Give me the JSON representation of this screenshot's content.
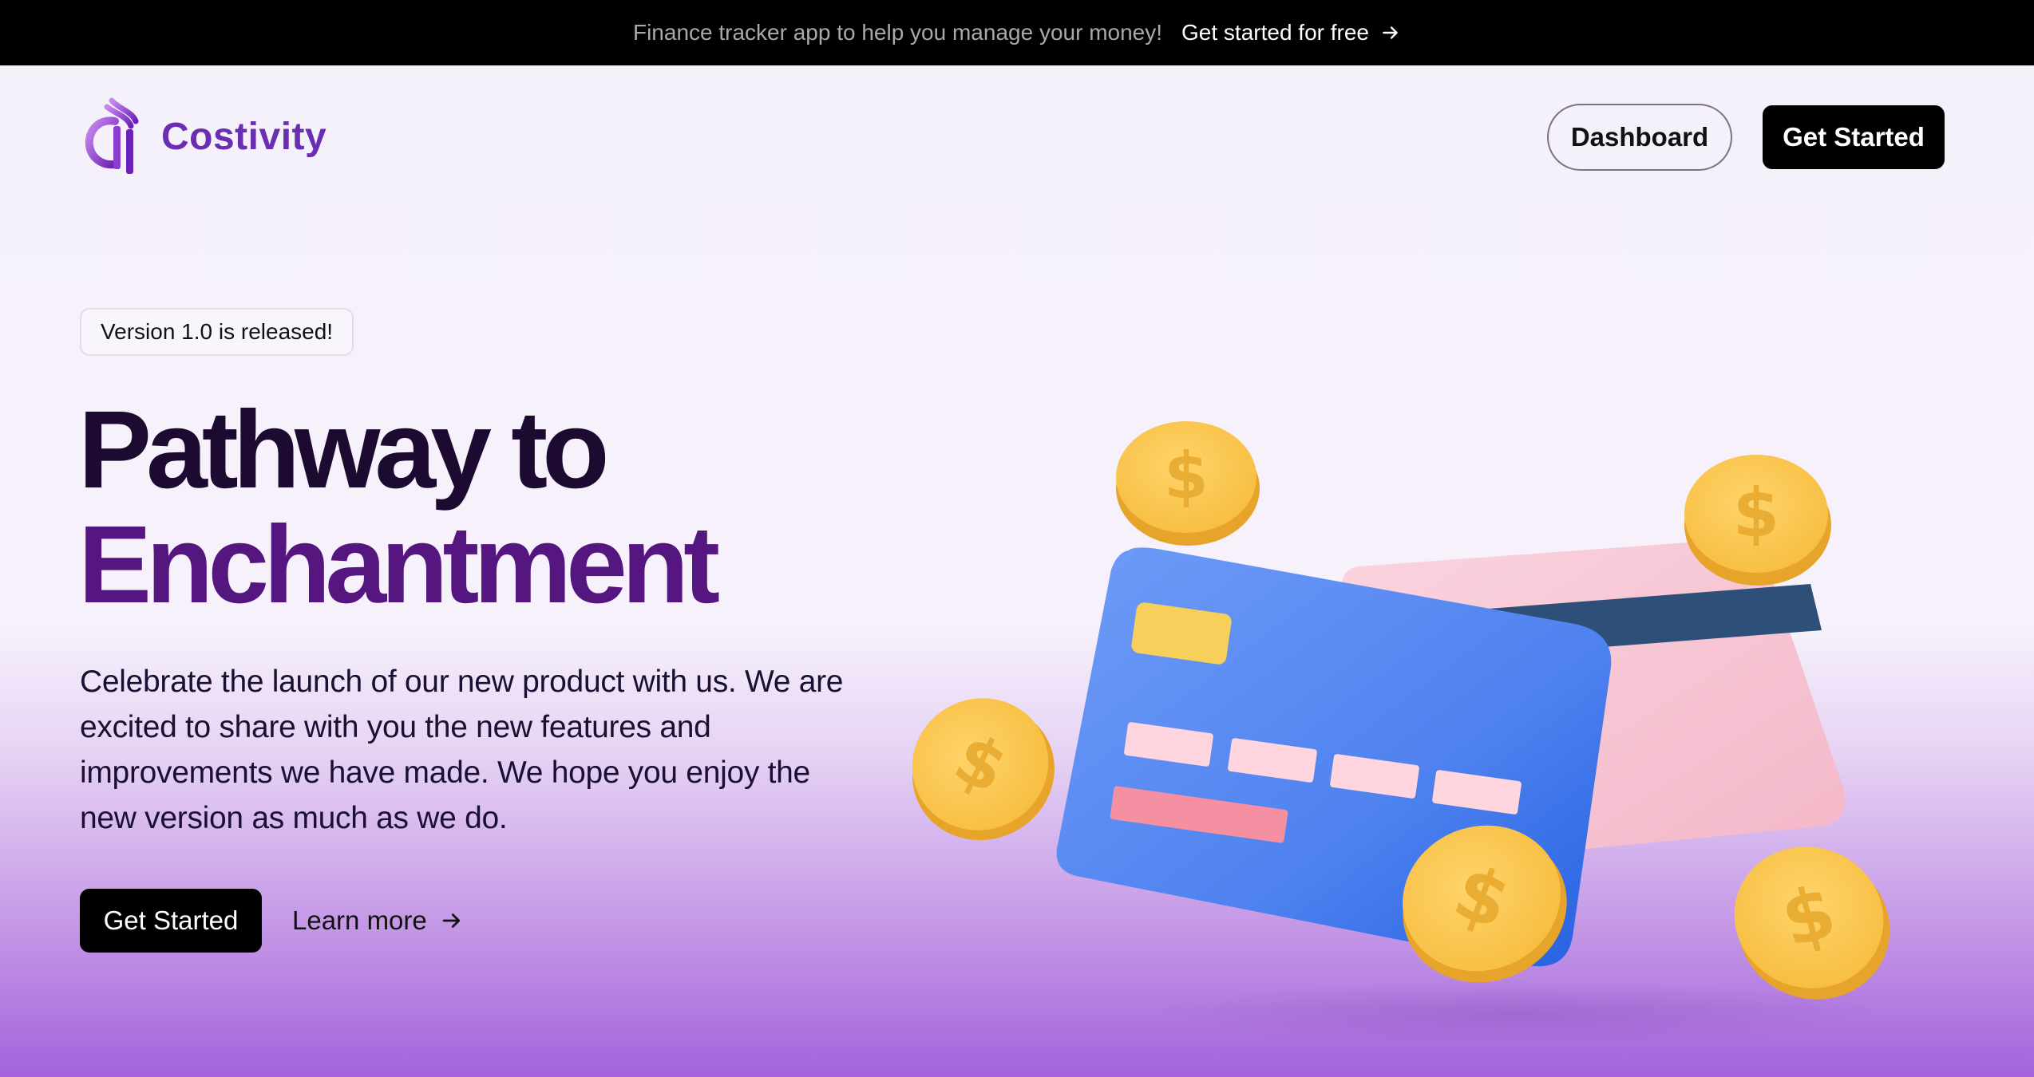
{
  "announcement": {
    "message": "Finance tracker app to help you manage your money!",
    "cta_label": "Get started for free",
    "arrow_icon": "arrow-right-icon"
  },
  "header": {
    "brand_name": "Costivity",
    "logo_icon": "costivity-logo-icon",
    "dashboard_label": "Dashboard",
    "get_started_label": "Get Started"
  },
  "hero": {
    "badge": "Version 1.0 is released!",
    "title_line1": "Pathway to",
    "title_line2": "Enchantment",
    "description": "Celebrate the launch of our new product with us. We are excited to share with you the new features and improvements we have made. We hope you enjoy the new version as much as we do.",
    "primary_cta": "Get Started",
    "secondary_cta": "Learn more",
    "illustration": "credit-cards-and-coins-illustration"
  },
  "colors": {
    "brand_purple": "#6a2fb0",
    "title_dark": "#1c0a30",
    "title_purple": "#561680",
    "coin_yellow": "#fbc64e",
    "card_blue": "#4a7ef0",
    "card_pink": "#f7c4d3"
  }
}
